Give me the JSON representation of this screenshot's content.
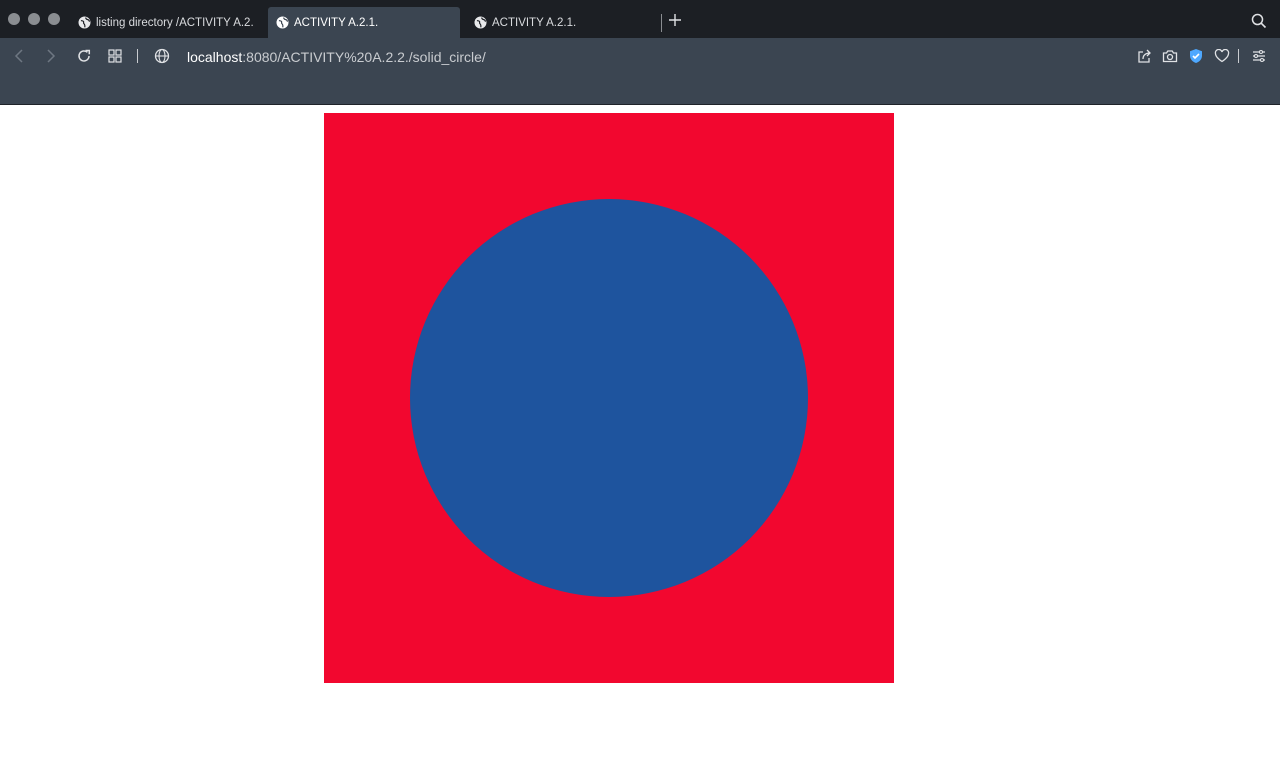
{
  "browser": {
    "tabs": [
      {
        "title": "listing directory /ACTIVITY A.2.",
        "active": false
      },
      {
        "title": "ACTIVITY A.2.1.",
        "active": true
      },
      {
        "title": "ACTIVITY A.2.1.",
        "active": false
      }
    ],
    "address": {
      "host": "localhost",
      "path": ":8080/ACTIVITY%20A.2.2./solid_circle/"
    },
    "icons": {
      "traffic_lights": [
        "close-icon",
        "minimize-icon",
        "maximize-icon"
      ],
      "tab_favicon": "globe-icon",
      "new_tab": "plus-icon",
      "tab_search": "search-icon",
      "nav": [
        "back-icon",
        "forward-icon",
        "reload-icon",
        "tiles-icon"
      ],
      "site_info": "globe-icon",
      "right": [
        "share-icon",
        "camera-icon",
        "shield-icon",
        "heart-icon",
        "settings-icon"
      ]
    }
  },
  "content": {
    "background_color": "#f2072f",
    "circle_color": "#1e549e"
  }
}
